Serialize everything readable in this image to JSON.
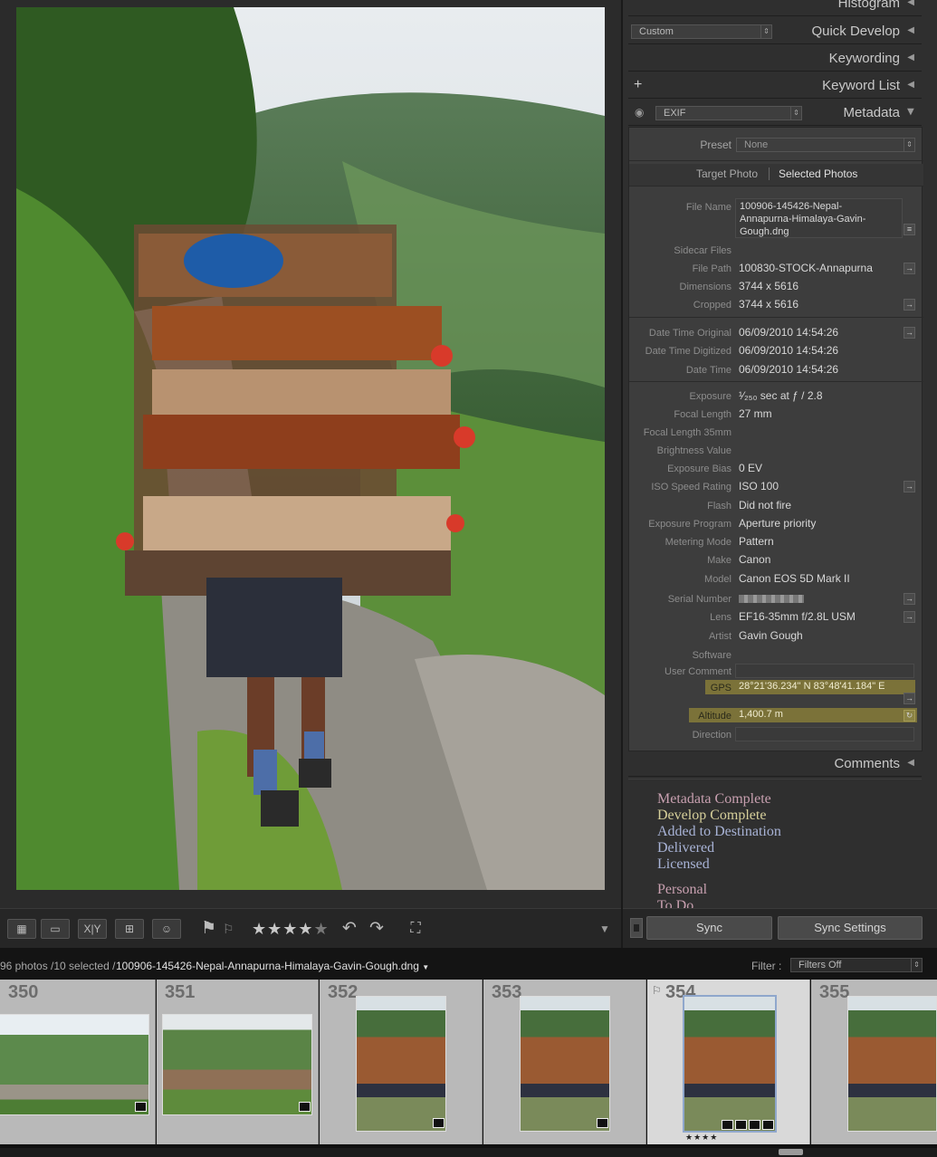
{
  "panel": {
    "headers": {
      "histogram": "Histogram",
      "quick_develop": "Quick Develop",
      "keywording": "Keywording",
      "keyword_list": "Keyword List",
      "metadata": "Metadata",
      "comments": "Comments"
    },
    "quick_develop_preset": "Custom",
    "metadata_view": "EXIF",
    "keyword_list_plus": "+",
    "preset_label": "Preset",
    "preset_value": "None",
    "tabs": [
      "Target Photo",
      "Selected Photos"
    ],
    "fields": {
      "file_name_label": "File Name",
      "file_name_value": "100906-145426-Nepal-Annapurna-Himalaya-Gavin-Gough.dng",
      "file_name_lines": [
        "100906-145426-Nepal-",
        "Annapurna-Himalaya-Gavin-",
        "Gough.dng"
      ],
      "sidecar_label": "Sidecar Files",
      "file_path_label": "File Path",
      "file_path_value": "100830-STOCK-Annapurna",
      "dimensions_label": "Dimensions",
      "dimensions_value": "3744 x 5616",
      "cropped_label": "Cropped",
      "cropped_value": "3744 x 5616",
      "dto_label": "Date Time Original",
      "dto_value": "06/09/2010 14:54:26",
      "dtd_label": "Date Time Digitized",
      "dtd_value": "06/09/2010 14:54:26",
      "dt_label": "Date Time",
      "dt_value": "06/09/2010 14:54:26",
      "exposure_label": "Exposure",
      "exposure_value": "¹⁄₂₅₀ sec at ƒ / 2.8",
      "focal_label": "Focal Length",
      "focal_value": "27 mm",
      "focal35_label": "Focal Length 35mm",
      "brightness_label": "Brightness Value",
      "bias_label": "Exposure Bias",
      "bias_value": "0 EV",
      "iso_label": "ISO Speed Rating",
      "iso_value": "ISO 100",
      "flash_label": "Flash",
      "flash_value": "Did not fire",
      "program_label": "Exposure Program",
      "program_value": "Aperture priority",
      "metering_label": "Metering Mode",
      "metering_value": "Pattern",
      "make_label": "Make",
      "make_value": "Canon",
      "model_label": "Model",
      "model_value": "Canon EOS 5D Mark II",
      "serial_label": "Serial Number",
      "lens_label": "Lens",
      "lens_value": "EF16-35mm f/2.8L USM",
      "artist_label": "Artist",
      "artist_value": "Gavin Gough",
      "software_label": "Software",
      "user_comment_label": "User Comment",
      "gps_label": "GPS",
      "gps_value": "28°21'36.234\" N 83°48'41.184\" E",
      "altitude_label": "Altitude",
      "altitude_value": "1,400.7 m",
      "direction_label": "Direction"
    },
    "workflow": [
      "Metadata Complete",
      "Develop Complete",
      "Added to Destination",
      "Delivered",
      "Licensed",
      "Personal",
      "To Do"
    ],
    "sync": "Sync",
    "sync_settings": "Sync Settings"
  },
  "toolbar": {
    "xy": "X|Y",
    "stars": "★★★★★",
    "rating": 4
  },
  "filmstrip": {
    "summary": "96 photos /10 selected /",
    "filename": "100906-145426-Nepal-Annapurna-Himalaya-Gavin-Gough.dng",
    "filter_label": "Filter :",
    "filter_value": "Filters Off",
    "cells": [
      "350",
      "351",
      "352",
      "353",
      "354",
      "355"
    ],
    "selected_stars": "★★★★"
  },
  "colors": {
    "panel_bg": "#2f2f2f",
    "highlight": "#7b7239",
    "workflow_pink": "#c8a0b0",
    "workflow_yellow": "#d6cf9a",
    "workflow_blue": "#a8b3d6"
  }
}
